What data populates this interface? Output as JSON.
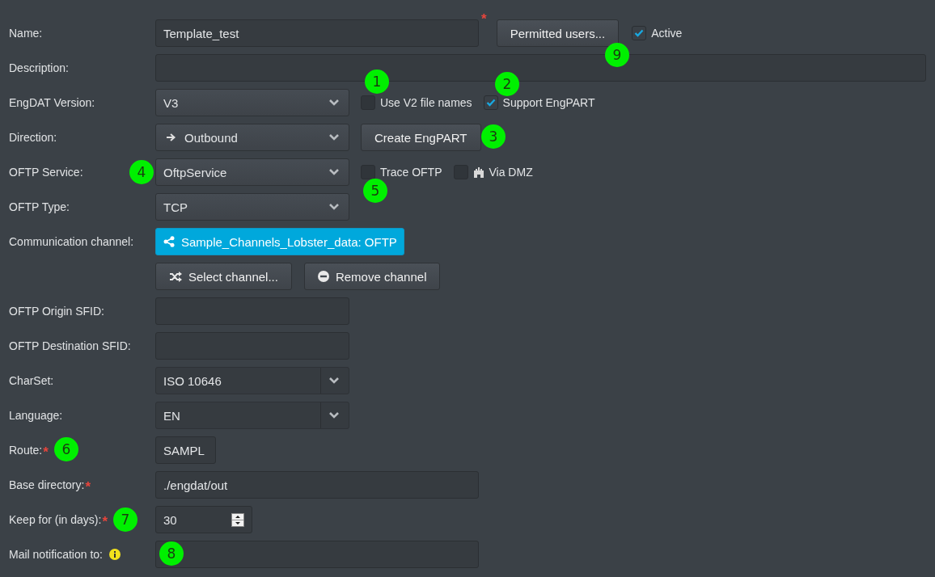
{
  "name": {
    "label": "Name:",
    "value": "Template_test",
    "required_mark": "*"
  },
  "permitted_users": {
    "label": "Permitted users..."
  },
  "active": {
    "label": "Active",
    "checked": true
  },
  "description": {
    "label": "Description:"
  },
  "engdat_version": {
    "label": "EngDAT Version:",
    "value": "V3",
    "kind": "dropdown"
  },
  "use_v2_file_names": {
    "label": "Use V2 file names",
    "checked": false
  },
  "support_engpart": {
    "label": "Support EngPART",
    "checked": true
  },
  "direction": {
    "label": "Direction:",
    "value": "Outbound",
    "kind": "dropdown"
  },
  "create_engpart": {
    "label": "Create EngPART"
  },
  "oftp_service": {
    "label": "OFTP Service:",
    "value": "OftpService",
    "kind": "dropdown"
  },
  "trace_oftp": {
    "label": "Trace OFTP",
    "checked": false
  },
  "via_dmz": {
    "label": "Via DMZ",
    "checked": false
  },
  "oftp_type": {
    "label": "OFTP Type:",
    "value": "TCP",
    "kind": "dropdown"
  },
  "communication_channel": {
    "label": "Communication channel:",
    "value": "Sample_Channels_Lobster_data: OFTP"
  },
  "select_channel": {
    "label": "Select channel..."
  },
  "remove_channel": {
    "label": "Remove channel"
  },
  "oftp_origin_sfid": {
    "label": "OFTP Origin SFID:"
  },
  "oftp_destination_sfid": {
    "label": "OFTP Destination SFID:"
  },
  "charset": {
    "label": "CharSet:",
    "value": "ISO 10646",
    "kind": "combobox"
  },
  "language": {
    "label": "Language:",
    "value": "EN",
    "kind": "combobox"
  },
  "route": {
    "label": "Route:",
    "value": "SAMPL",
    "required_mark": "*"
  },
  "base_directory": {
    "label": "Base directory:",
    "value": "./engdat/out",
    "required_mark": "*"
  },
  "keep_for": {
    "label": "Keep for (in days):",
    "value": "30",
    "required_mark": "*"
  },
  "mail_notification": {
    "label": "Mail notification to:"
  },
  "callouts": [
    {
      "text": "1"
    },
    {
      "text": "2"
    },
    {
      "text": "3"
    },
    {
      "text": "4"
    },
    {
      "text": "5"
    },
    {
      "text": "6"
    },
    {
      "text": "7"
    },
    {
      "text": "8"
    },
    {
      "text": "9"
    }
  ]
}
